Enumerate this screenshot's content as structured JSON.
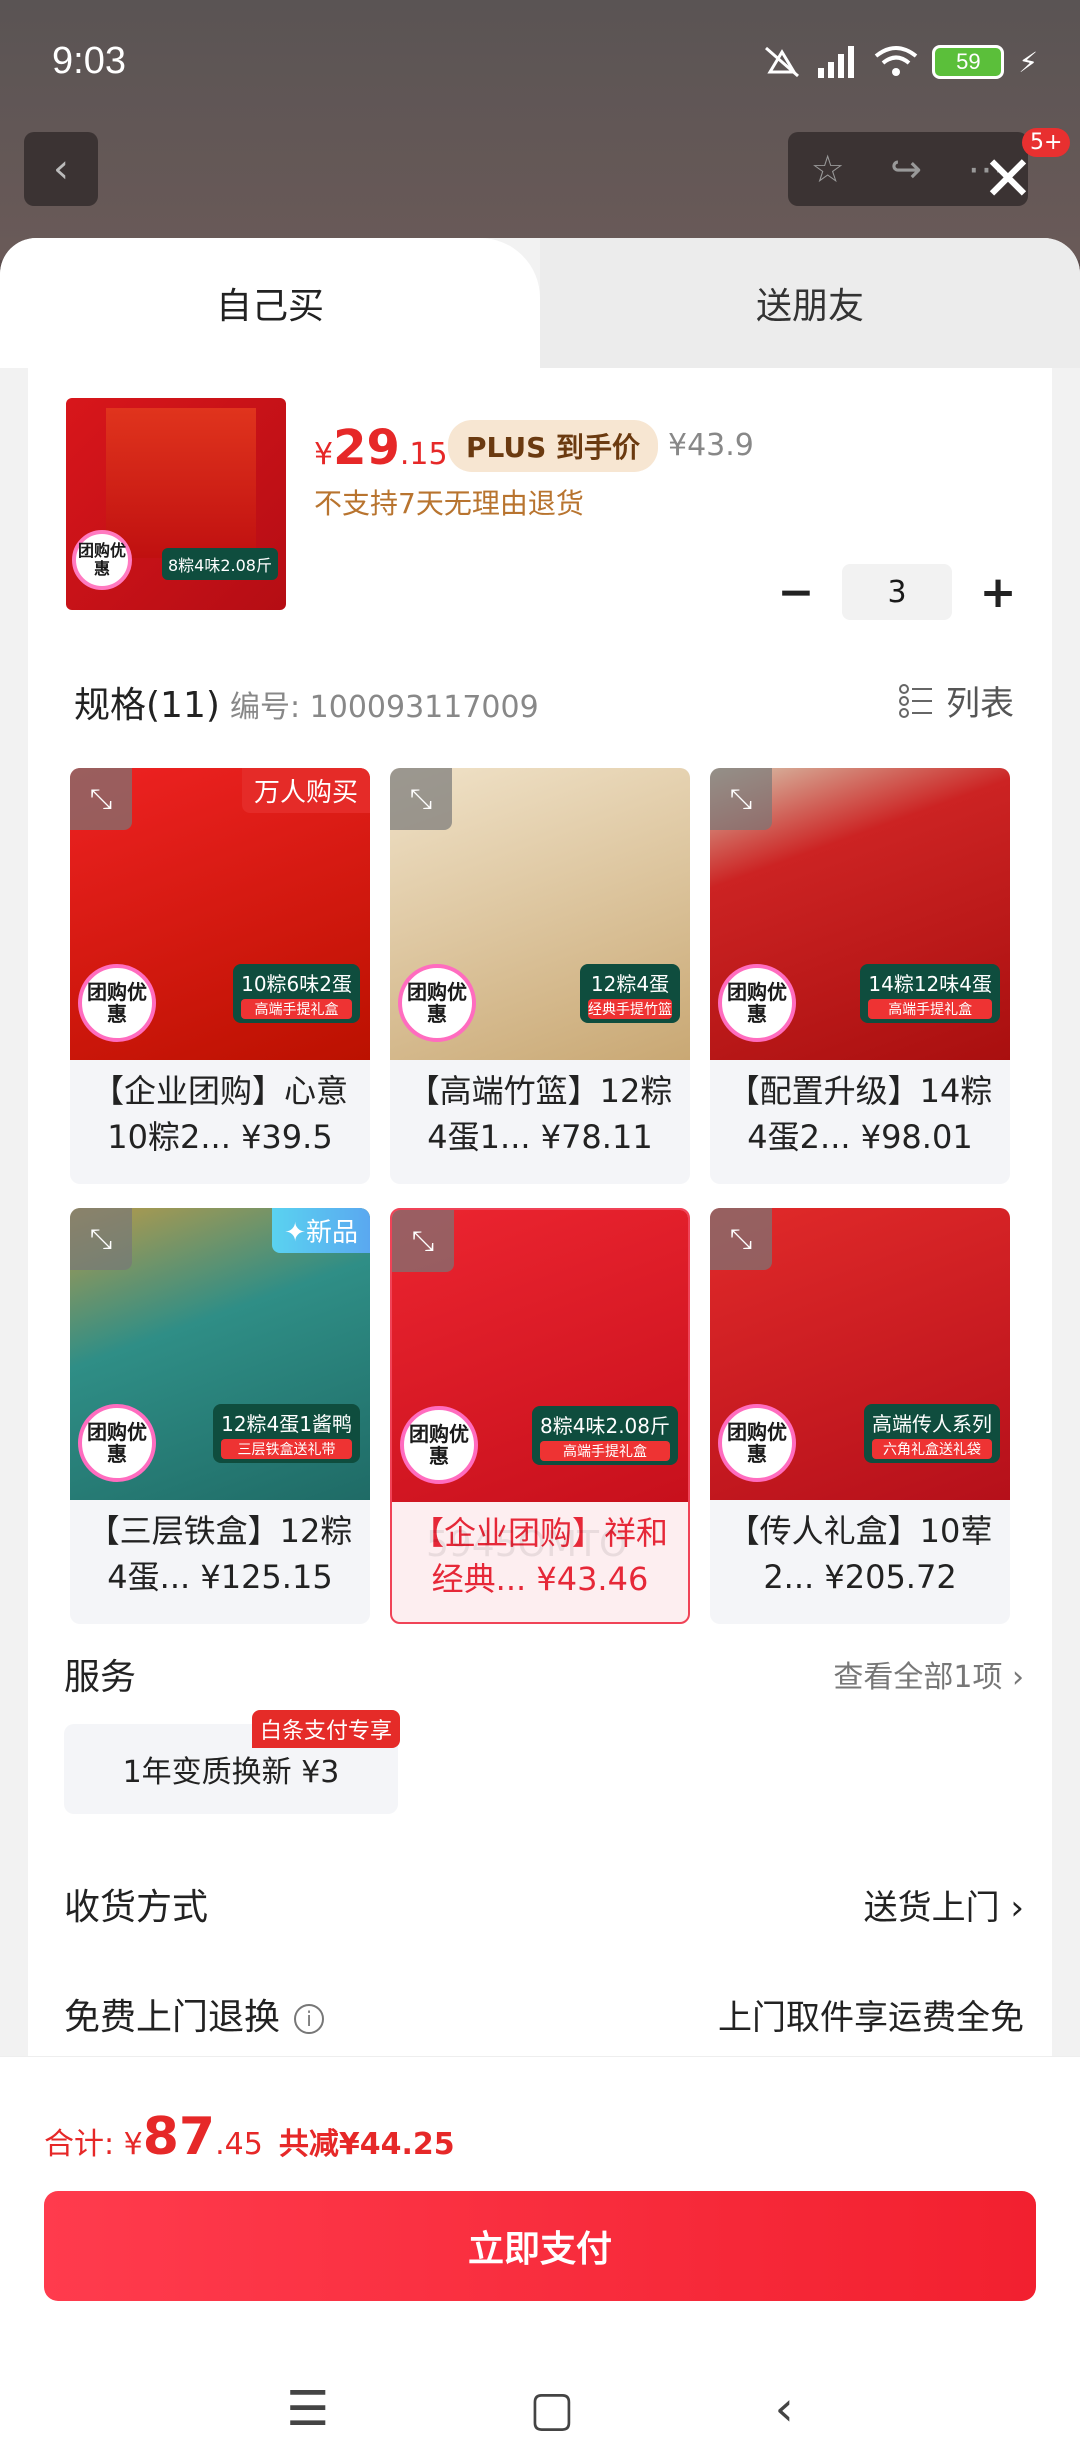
{
  "status_bar": {
    "time": "9:03",
    "battery": "59"
  },
  "page_bg": {
    "badge": "5+"
  },
  "tabs": [
    {
      "label": "自己买",
      "active": true
    },
    {
      "label": "送朋友",
      "active": false
    }
  ],
  "product": {
    "price_yen": "¥",
    "price_int": "29",
    "price_dec": ".15",
    "plus_label": "PLUS 到手价",
    "original_price": "¥43.9",
    "return_note": "不支持7天无理由退货",
    "quantity": "3",
    "thumb_tag": "8粽4味2.08斤",
    "thumb_group": "团购优惠"
  },
  "spec": {
    "title": "规格(11)",
    "code": "编号: 100093117009",
    "list_label": "列表"
  },
  "items": [
    {
      "label": "【企业团购】心意10粽2... ¥39.5",
      "badge": "万人购买",
      "tag": "10粽6味2蛋",
      "sub": "高端手提礼盒",
      "bg": "#d41b1b"
    },
    {
      "label": "【高端竹篮】12粽4蛋1... ¥78.11",
      "badge": "",
      "tag": "12粽4蛋",
      "sub": "经典手提竹篮",
      "bg": "#e8d6b6"
    },
    {
      "label": "【配置升级】14粽4蛋2... ¥98.01",
      "badge": "",
      "tag": "14粽12味4蛋",
      "sub": "高端手提礼盒",
      "bg": "#c81d1d"
    },
    {
      "label": "【三层铁盒】12粽4蛋... ¥125.15",
      "badge": "✦新品",
      "tag": "12粽4蛋1酱鸭",
      "sub": "三层铁盒送礼带",
      "bg": "#3c8f8a"
    },
    {
      "label": "【企业团购】祥和经典... ¥43.46",
      "badge": "",
      "tag": "8粽4味2.08斤",
      "sub": "高端手提礼盒",
      "bg": "#e0202a",
      "selected": true
    },
    {
      "label": "【传人礼盒】10荤2... ¥205.72",
      "badge": "",
      "tag": "高端传人系列",
      "sub": "六角礼盒送礼袋",
      "bg": "#d31a1f"
    }
  ],
  "watermark": "5945OMTO",
  "group_badge": "团购优惠",
  "services": {
    "title": "服务",
    "link": "查看全部1项 ›",
    "chip": "1年变质换新  ¥3",
    "chip_tag": "白条支付专享"
  },
  "delivery": {
    "title": "收货方式",
    "value": "送货上门 ›"
  },
  "free_return": {
    "title": "免费上门退换",
    "value": "上门取件享运费全免"
  },
  "footer": {
    "total_label": "合计: ¥",
    "total_int": "87",
    "total_dec": ".45",
    "discount": "共减¥44.25",
    "pay_label": "立即支付"
  }
}
